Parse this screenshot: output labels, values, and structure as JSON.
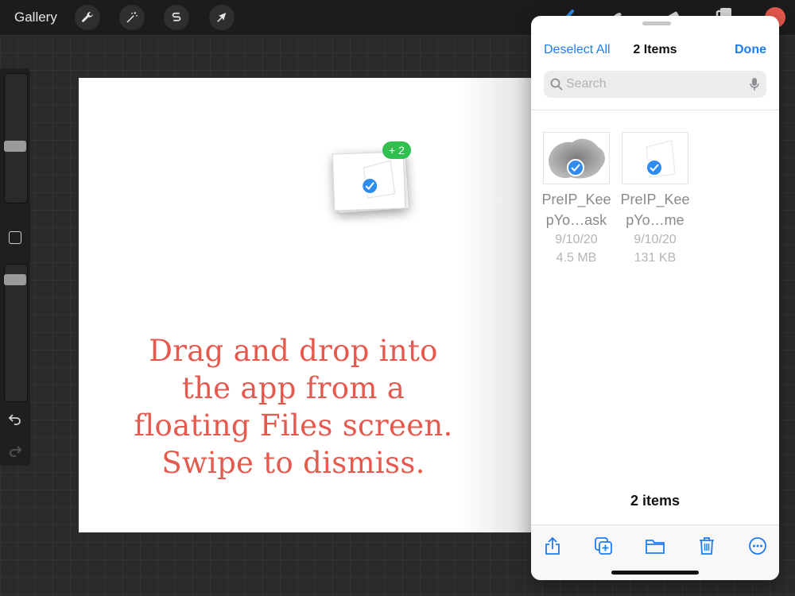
{
  "app": {
    "gallery_label": "Gallery",
    "accent_color": "#e4574c",
    "tools": [
      "wrench-icon",
      "magic-wand-icon",
      "selection-icon",
      "transform-arrow-icon"
    ],
    "right_tools": [
      "brush-icon",
      "smudge-icon",
      "eraser-icon",
      "layers-icon"
    ]
  },
  "canvas": {
    "caption_lines": [
      "Drag and drop into",
      "the app from a",
      "floating Files screen.",
      "Swipe to dismiss."
    ]
  },
  "drag": {
    "badge": "+ 2"
  },
  "files_panel": {
    "deselect_label": "Deselect All",
    "title": "2 Items",
    "done_label": "Done",
    "search_placeholder": "Search",
    "items": [
      {
        "name_line1": "PreIP_Kee",
        "name_line2": "pYo…ask",
        "date": "9/10/20",
        "size": "4.5 MB",
        "selected": true
      },
      {
        "name_line1": "PreIP_Kee",
        "name_line2": "pYo…me",
        "date": "9/10/20",
        "size": "131 KB",
        "selected": true
      }
    ],
    "count_label": "2 items",
    "toolbar": [
      "share-icon",
      "duplicate-icon",
      "folder-icon",
      "trash-icon",
      "more-icon"
    ],
    "accent_color": "#1e7cf2"
  }
}
